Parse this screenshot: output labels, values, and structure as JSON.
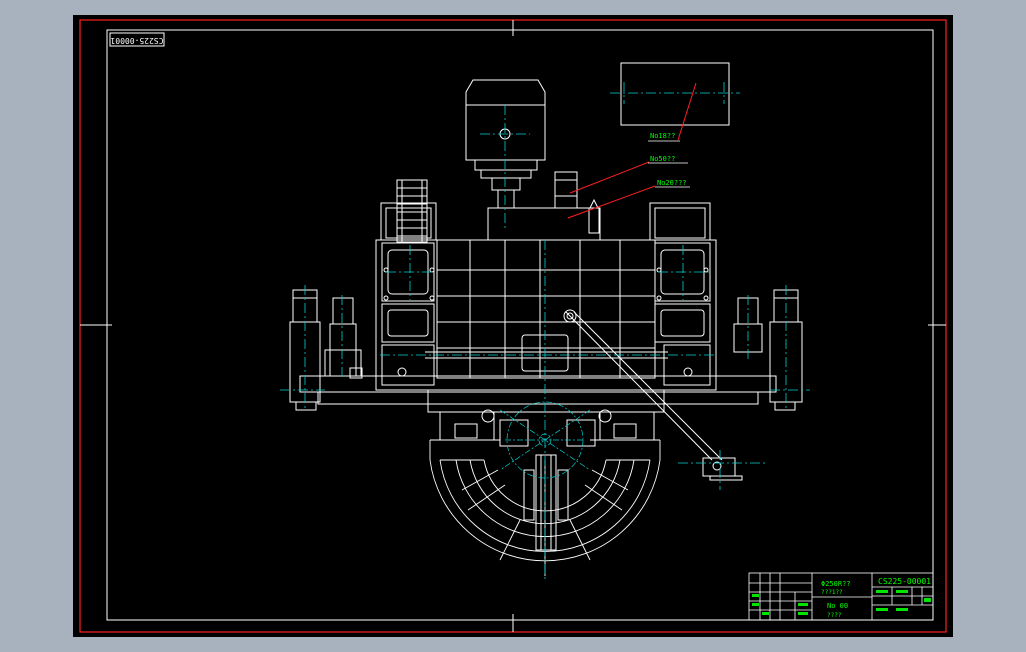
{
  "drawing": {
    "code_box": "CS225-00001",
    "callouts": {
      "c1": "No18??",
      "c2": "No50??",
      "c3": "No20???"
    },
    "title_block": {
      "mid_line1": "Φ250R??",
      "mid_line2": "???1??",
      "mid_line3": "No 00",
      "mid_line4": "????",
      "code": "CS225-00001"
    }
  },
  "colors": {
    "background": "#a8b2bf",
    "canvas": "#000000",
    "line_white": "#ffffff",
    "centerline": "#00d0d0",
    "leader": "#ff2020",
    "text": "#00ff00",
    "border": "#ff2020"
  }
}
